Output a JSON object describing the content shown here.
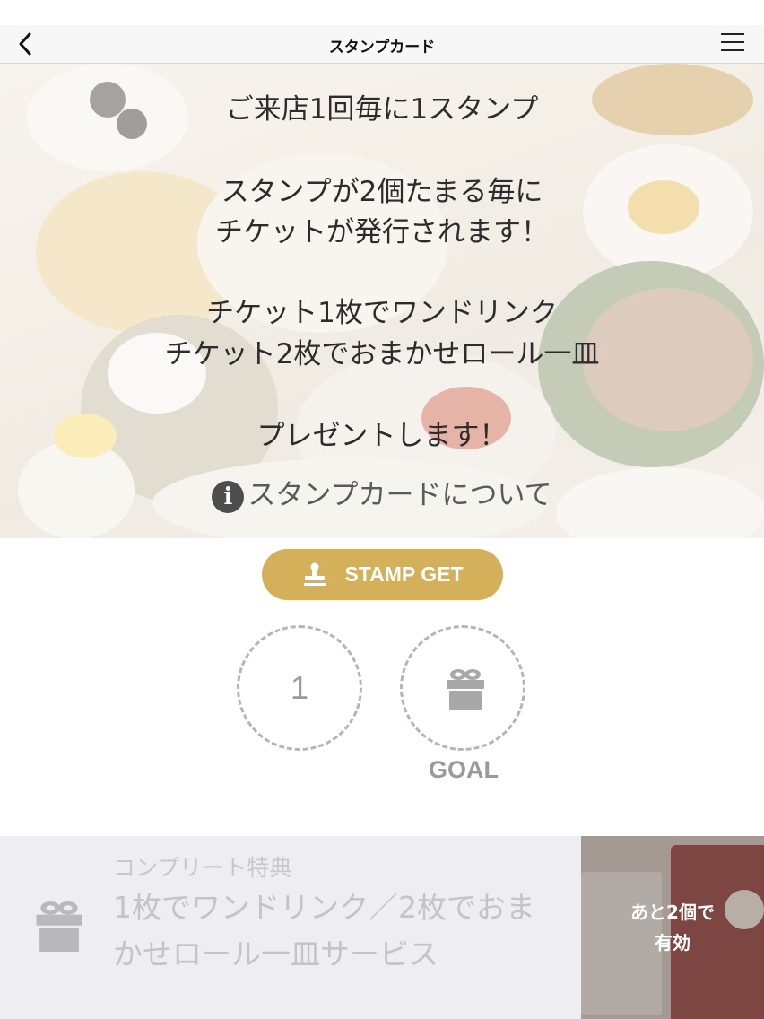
{
  "nav": {
    "title": "スタンプカード"
  },
  "hero": {
    "line1": "ご来店1回毎に1スタンプ",
    "line2": "スタンプが2個たまる毎に",
    "line3": "チケットが発行されます！",
    "line4": "チケット1枚でワンドリンク",
    "line5": "チケット2枚でおまかせロール一皿",
    "line6": "プレゼントします！",
    "info_link": "スタンプカードについて"
  },
  "stamp_button": {
    "label": "STAMP GET"
  },
  "stamps": {
    "slot1_number": "1",
    "goal_label": "GOAL"
  },
  "complete": {
    "label": "コンプリート特典",
    "text": "1枚でワンドリンク／2枚でおまかせロール一皿サービス",
    "status_line1": "あと2個で",
    "status_line2": "有効"
  },
  "colors": {
    "accent": "#d4b05a",
    "slot_border": "#b5b5b5",
    "bottom_bg": "#eeeef2"
  },
  "icons": {
    "back": "chevron-left-icon",
    "menu": "hamburger-menu-icon",
    "info": "info-icon",
    "stamp": "stamp-icon",
    "gift": "gift-icon"
  }
}
